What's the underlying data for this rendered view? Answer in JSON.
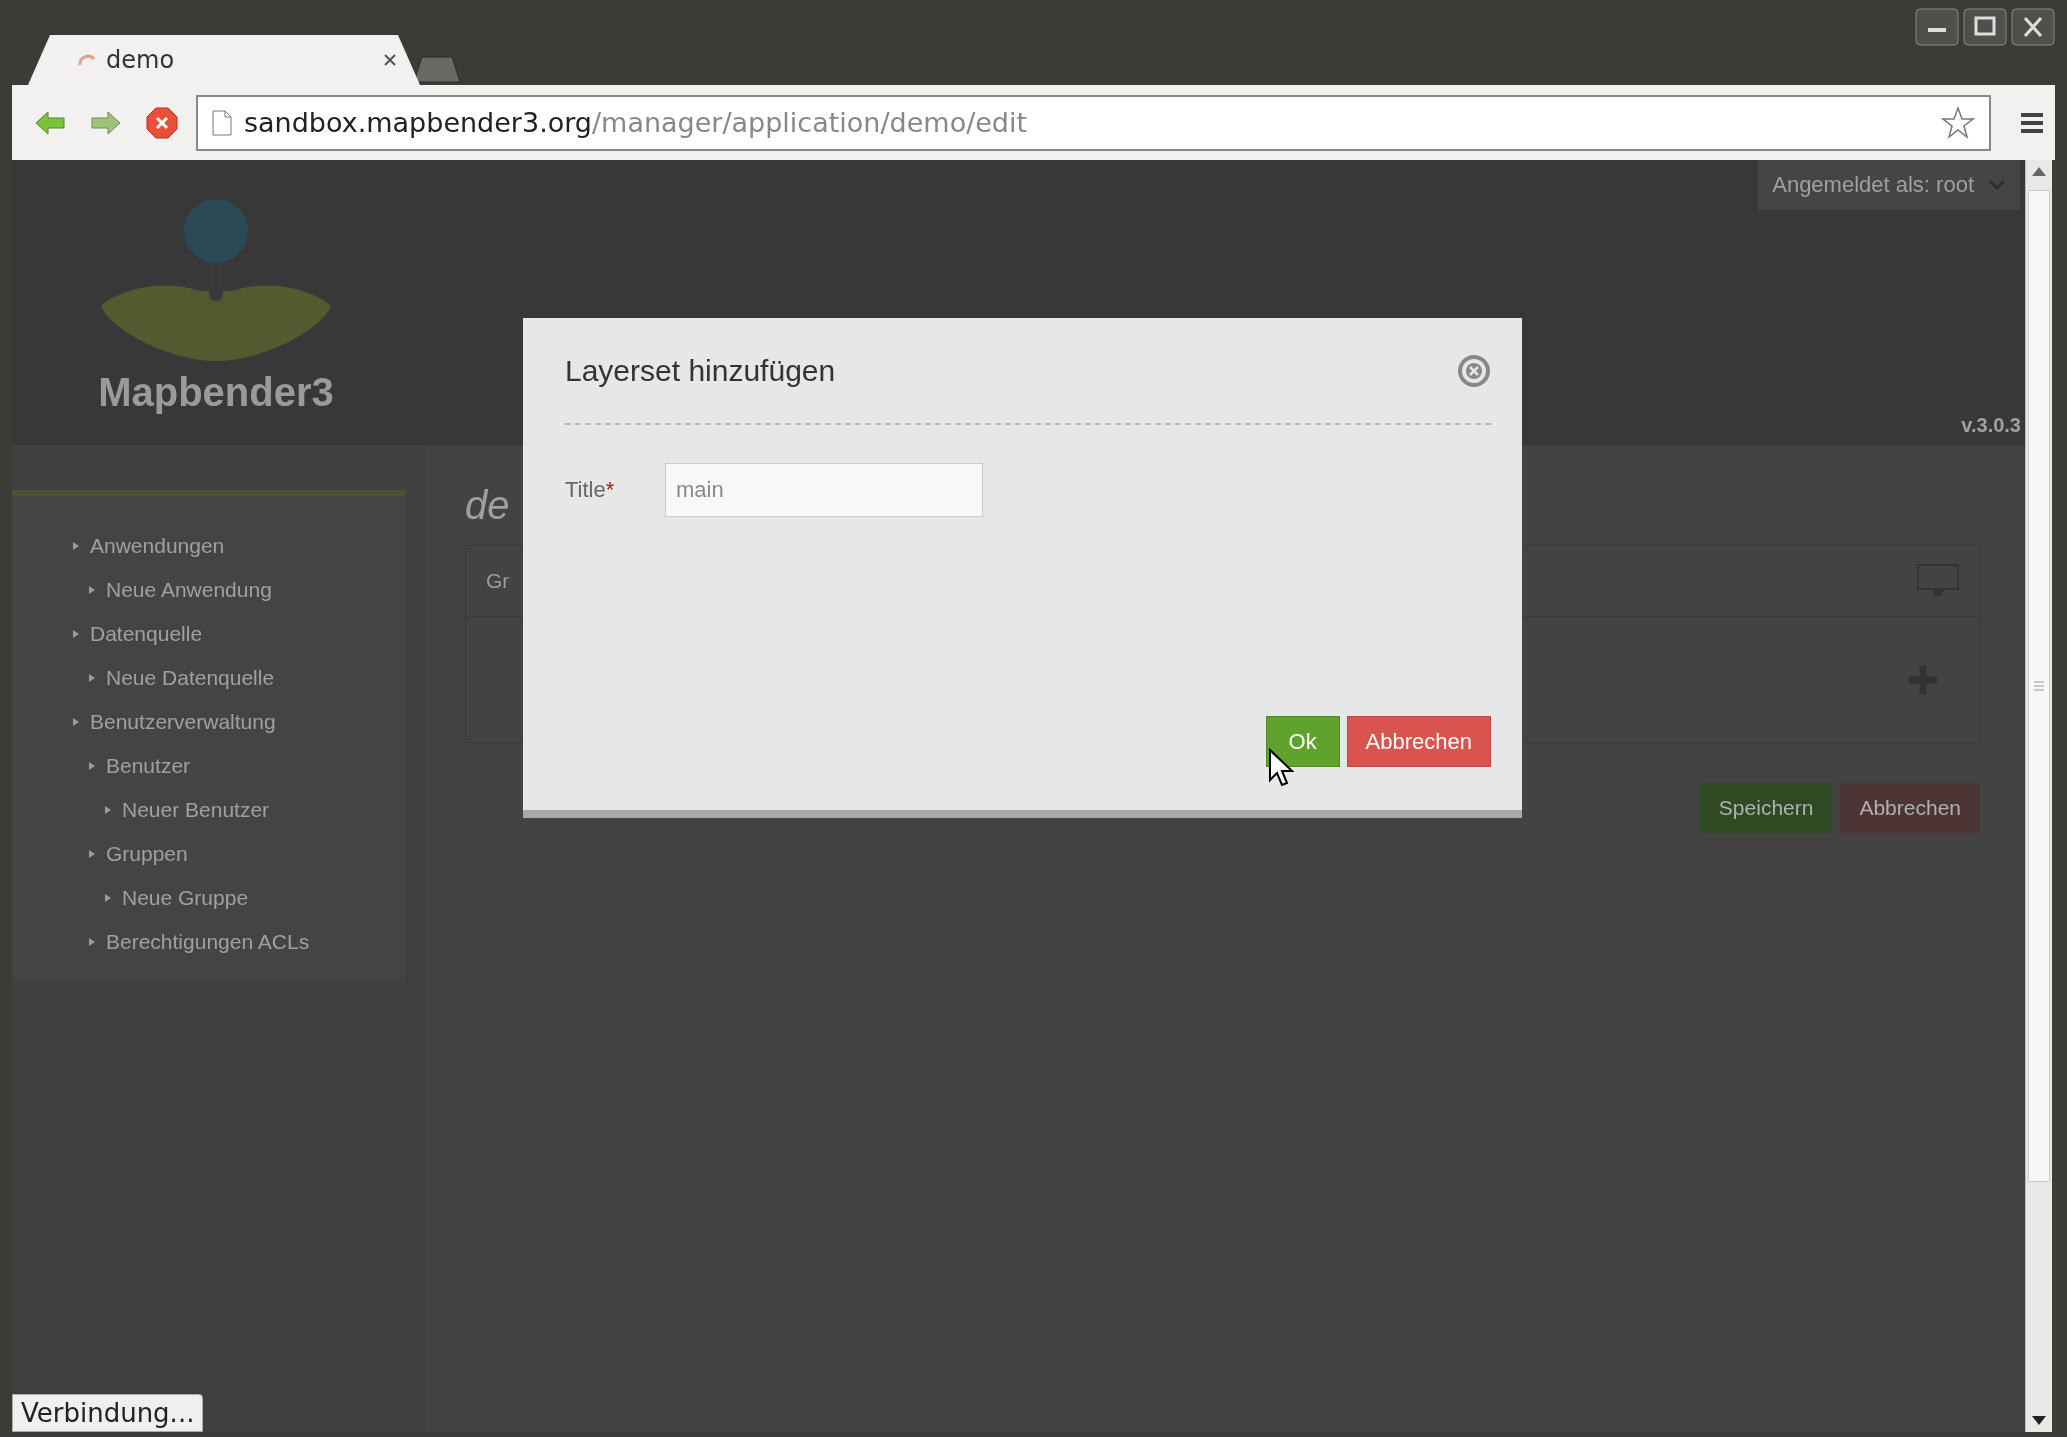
{
  "browser": {
    "tabs": [
      {
        "title": "demo",
        "selected": true
      }
    ],
    "address_bar": {
      "host": "sandbox.mapbender3.org",
      "path": "/manager/application/demo/edit"
    }
  },
  "page": {
    "user_menu": "Angemeldet als: root",
    "logo_text": "Mapbender3",
    "version": "v.3.0.3",
    "sidebar": {
      "items": [
        {
          "label": "Anwendungen",
          "children": [
            {
              "label": "Neue Anwendung"
            }
          ]
        },
        {
          "label": "Datenquelle",
          "children": [
            {
              "label": "Neue Datenquelle"
            }
          ]
        },
        {
          "label": "Benutzerverwaltung",
          "children": [
            {
              "label": "Benutzer",
              "children": [
                {
                  "label": "Neuer Benutzer"
                }
              ]
            },
            {
              "label": "Gruppen",
              "children": [
                {
                  "label": "Neue Gruppe"
                }
              ]
            },
            {
              "label": "Berechtigungen ACLs"
            }
          ]
        }
      ]
    },
    "heading": "de",
    "tab_label": "Gr",
    "buttons": [
      {
        "label": "Speichern",
        "kind": "primary"
      },
      {
        "label": "Abbrechen",
        "kind": "danger"
      }
    ]
  },
  "dialog": {
    "title": "Layerset hinzufügen",
    "fields": [
      {
        "label": "Title",
        "required_mark": "*",
        "value": "main"
      }
    ],
    "buttons": [
      {
        "label": "Ok",
        "kind": "primary"
      },
      {
        "label": "Abbrechen",
        "kind": "danger"
      }
    ]
  },
  "status": "Verbindung..."
}
